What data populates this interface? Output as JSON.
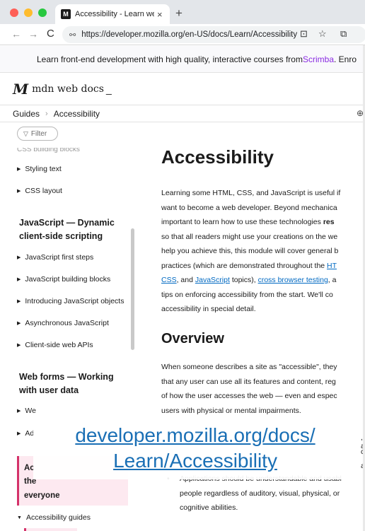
{
  "browser": {
    "tab_title": "Accessibility - Learn web dev",
    "tab_favicon": "M",
    "tab_close": "×",
    "new_tab": "+",
    "url": "https://developer.mozilla.org/en-US/docs/Learn/Accessibility",
    "icons": {
      "back": "←",
      "forward": "→",
      "reload": "C",
      "site_info": "⚯",
      "install": "⊡",
      "star": "☆",
      "extensions": "⧉"
    }
  },
  "promo": {
    "text": "Learn front-end development with high quality, interactive courses from ",
    "link": "Scrimba",
    "tail": ". Enro"
  },
  "header": {
    "logo_mark": "M",
    "logo_text": "mdn web docs",
    "logo_cursor": "_"
  },
  "breadcrumb": {
    "items": [
      "Guides",
      "Accessibility"
    ],
    "separator": "›",
    "lang_icon": "⊕"
  },
  "sidebar": {
    "filter_label": "Filter",
    "clipped_item": "CSS building blocks",
    "items": [
      {
        "label": "Styling text"
      },
      {
        "label": "CSS layout"
      },
      {
        "label": "JavaScript first steps"
      },
      {
        "label": "JavaScript building blocks"
      },
      {
        "label": "Introducing JavaScript objects"
      },
      {
        "label": "Asynchronous JavaScript"
      },
      {
        "label": "Client-side web APIs"
      },
      {
        "label": "We"
      },
      {
        "label": "Ad"
      },
      {
        "label": "Accessibility guides"
      }
    ],
    "heading_js": [
      "JavaScript — Dynamic",
      "client-side scripting"
    ],
    "heading_forms": [
      "Web forms — Working",
      "with user data"
    ],
    "active_lines": [
      "Ac",
      "the",
      "everyone"
    ],
    "arrow_closed": "▶",
    "arrow_open": "▼"
  },
  "main": {
    "title": "Accessibility",
    "intro": {
      "l1": "Learning some HTML, CSS, and JavaScript is useful if",
      "l2": "want to become a web developer. Beyond mechanica",
      "l3a": "important to learn how to use these technologies ",
      "l3b": "res",
      "l4": "so that all readers might use your creations on the we",
      "l5": "help you achieve this, this module will cover general b",
      "l6a": "practices (which are demonstrated throughout the ",
      "l6b": "HT",
      "l7a": "CSS",
      "l7b": ", and ",
      "l7c": "JavaScript",
      "l7d": " topics), ",
      "l7e": "cross browser testing",
      "l7f": ", a",
      "l8": "tips on enforcing accessibility from the start. We'll co",
      "l9": "accessibility in special detail."
    },
    "overview_heading": "Overview",
    "overview": {
      "l1": "When someone describes a site as \"accessible\", they",
      "l2": "that any user can use all its features and content, reg",
      "l3": "of how the user accesses the web — even and espec",
      "l4": "users with physical or mental impairments."
    },
    "stubs": [
      ", a",
      "cc",
      "an"
    ],
    "bullet": {
      "dot": "•",
      "l1": "Applications should be understandable and usabl",
      "l2": "people regardless of auditory, visual, physical, or",
      "l3": "cognitive abilities."
    }
  },
  "overlay": {
    "line1": "developer.mozilla.org/docs/",
    "line2": "Learn/Accessibility"
  },
  "colors": {
    "link": "#0069c2",
    "accent": "#8a2be2",
    "active_bg": "#fde9f0",
    "active_border": "#d4326a",
    "overlay_text": "#1a6fb5"
  }
}
